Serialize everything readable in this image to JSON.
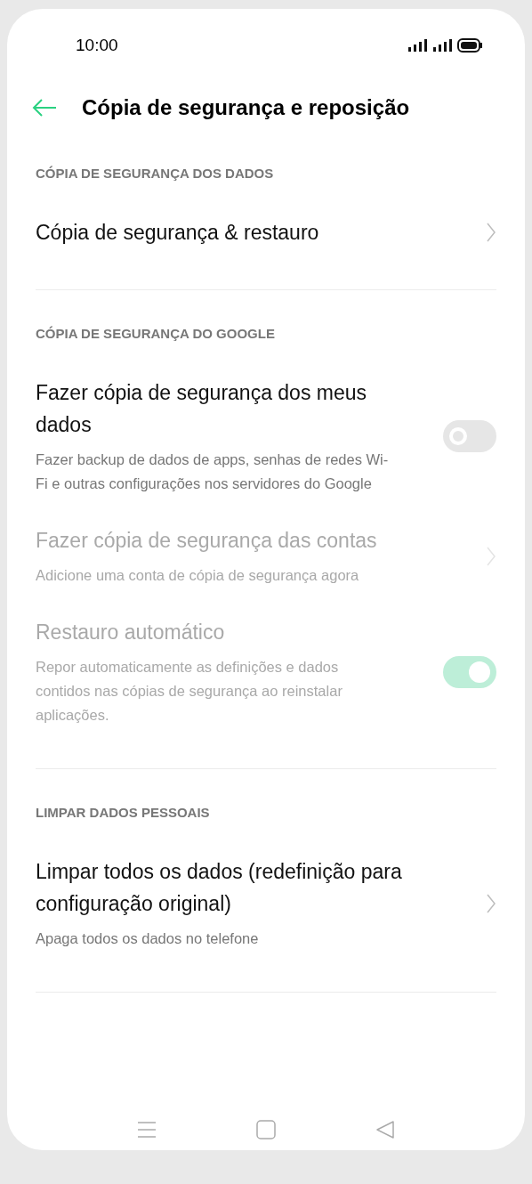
{
  "status_bar": {
    "time": "10:00"
  },
  "header": {
    "title": "Cópia de segurança e reposição"
  },
  "sections": [
    {
      "heading": "CÓPIA DE SEGURANÇA DOS DADOS",
      "items": [
        {
          "kind": "link",
          "title": "Cópia de segurança & restauro",
          "disabled": false
        }
      ]
    },
    {
      "heading": "CÓPIA DE SEGURANÇA DO GOOGLE",
      "items": [
        {
          "kind": "toggle",
          "title": "Fazer cópia de segurança dos meus dados",
          "subtitle": "Fazer backup de dados de apps, senhas de redes Wi-Fi e outras configurações nos servidores do Google",
          "disabled": false,
          "on": false
        },
        {
          "kind": "link",
          "title": "Fazer cópia de segurança das contas",
          "subtitle": "Adicione uma conta de cópia de segurança agora",
          "disabled": true
        },
        {
          "kind": "toggle",
          "title": "Restauro automático",
          "subtitle": "Repor automaticamente as definições e dados contidos nas cópias de segurança ao reinstalar aplicações.",
          "disabled": true,
          "on": true
        }
      ]
    },
    {
      "heading": "LIMPAR DADOS PESSOAIS",
      "items": [
        {
          "kind": "link",
          "title": "Limpar todos os dados (redefinição para configuração original)",
          "subtitle": "Apaga todos os dados no telefone",
          "disabled": false
        }
      ]
    }
  ]
}
